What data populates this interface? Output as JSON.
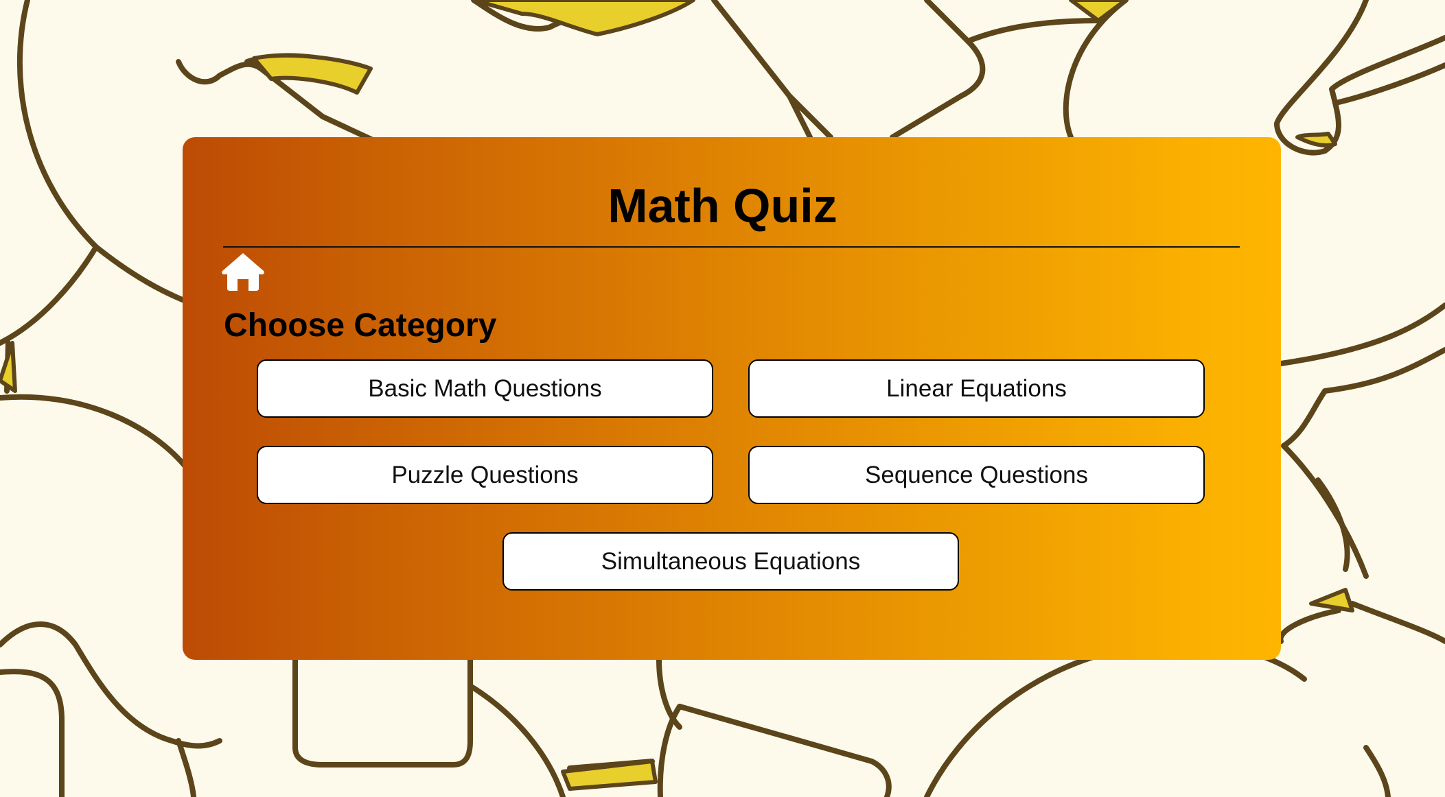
{
  "app": {
    "title": "Math Quiz",
    "home_icon": "home-icon"
  },
  "category": {
    "heading": "Choose Category",
    "buttons": [
      {
        "label": "Basic Math Questions"
      },
      {
        "label": "Linear Equations"
      },
      {
        "label": "Puzzle Questions"
      },
      {
        "label": "Sequence Questions"
      },
      {
        "label": "Simultaneous Equations"
      }
    ]
  },
  "colors": {
    "page_background": "#fdfaec",
    "doodle_stroke": "#5c451a",
    "doodle_fill": "#e8cf2c",
    "gradient_start": "#bd4b05",
    "gradient_end": "#feb500",
    "button_background": "#ffffff"
  }
}
